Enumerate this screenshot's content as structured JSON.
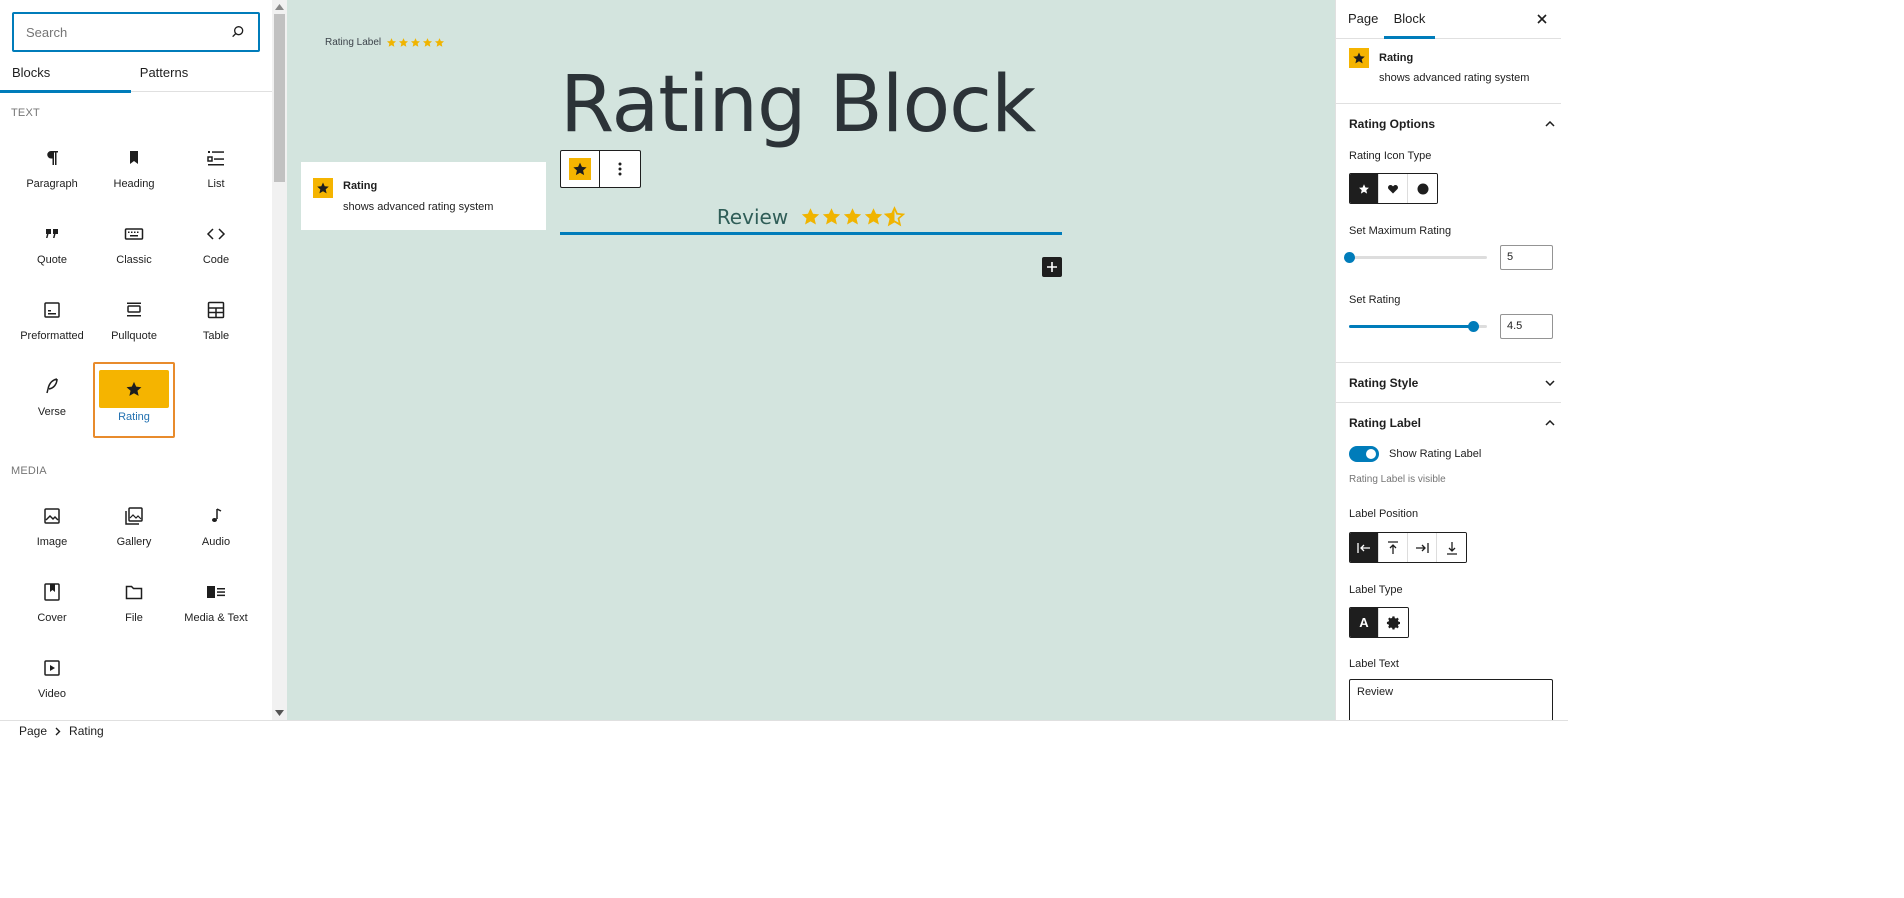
{
  "inserter": {
    "search_placeholder": "Search",
    "tabs": [
      "Blocks",
      "Patterns"
    ],
    "categories": {
      "text": {
        "label": "TEXT",
        "items": [
          {
            "label": "Paragraph",
            "icon": "paragraph-icon"
          },
          {
            "label": "Heading",
            "icon": "bookmark-icon"
          },
          {
            "label": "List",
            "icon": "list-icon"
          },
          {
            "label": "Quote",
            "icon": "quote-icon"
          },
          {
            "label": "Classic",
            "icon": "keyboard-icon"
          },
          {
            "label": "Code",
            "icon": "code-icon"
          },
          {
            "label": "Preformatted",
            "icon": "preformatted-icon"
          },
          {
            "label": "Pullquote",
            "icon": "pullquote-icon"
          },
          {
            "label": "Table",
            "icon": "table-icon"
          },
          {
            "label": "Verse",
            "icon": "feather-icon"
          },
          {
            "label": "Rating",
            "icon": "star-icon"
          }
        ]
      },
      "media": {
        "label": "MEDIA",
        "items": [
          {
            "label": "Image",
            "icon": "image-icon"
          },
          {
            "label": "Gallery",
            "icon": "gallery-icon"
          },
          {
            "label": "Audio",
            "icon": "audio-icon"
          },
          {
            "label": "Cover",
            "icon": "cover-icon"
          },
          {
            "label": "File",
            "icon": "folder-icon"
          },
          {
            "label": "Media & Text",
            "icon": "media-text-icon"
          },
          {
            "label": "Video",
            "icon": "video-icon"
          }
        ]
      }
    }
  },
  "canvas": {
    "rating_label_text": "Rating Label",
    "rating_label_stars": 5,
    "title": "Rating Block",
    "preview": {
      "name": "Rating",
      "description": "shows advanced rating system"
    },
    "review_text": "Review",
    "review_rating": 4.5,
    "review_max": 5
  },
  "sidebar": {
    "tabs": [
      "Page",
      "Block"
    ],
    "block": {
      "name": "Rating",
      "description": "shows advanced rating system"
    },
    "rating_options": {
      "title": "Rating Options",
      "icon_type_label": "Rating Icon Type",
      "icon_types": [
        "star-icon",
        "heart-icon",
        "circle-icon"
      ],
      "max_label": "Set Maximum Rating",
      "max_value": "5",
      "max_fraction": 0,
      "rating_label": "Set Rating",
      "rating_value": "4.5",
      "rating_fraction": 0.9
    },
    "rating_style": {
      "title": "Rating Style"
    },
    "rating_label_panel": {
      "title": "Rating Label",
      "toggle_label": "Show Rating Label",
      "toggle_help": "Rating Label is visible",
      "position_label": "Label Position",
      "positions": [
        "align-left-icon",
        "align-top-icon",
        "align-right-icon",
        "align-bottom-icon"
      ],
      "type_label": "Label Type",
      "types": [
        "text-type-icon",
        "gear-icon"
      ],
      "text_label": "Label Text",
      "text_value": "Review"
    }
  },
  "breadcrumb": [
    "Page",
    "Rating"
  ],
  "colors": {
    "accent": "#007cba",
    "star": "#f0b400",
    "canvas_bg": "#d3e4de",
    "selected_border": "#e88b2c"
  }
}
